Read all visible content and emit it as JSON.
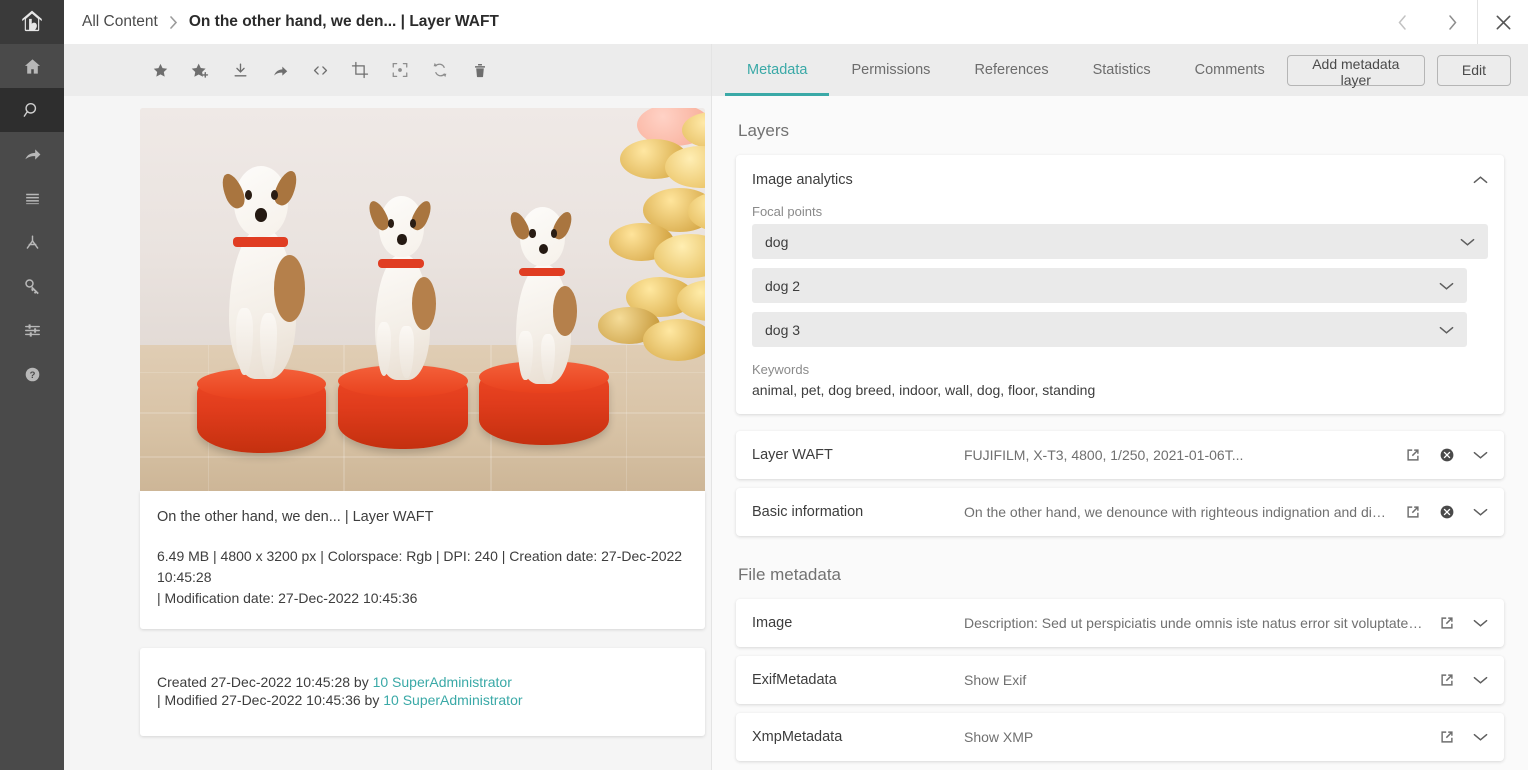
{
  "brand": {
    "accent": "#3aa9a7",
    "logo_icon": "house-monogram-logo"
  },
  "header": {
    "breadcrumb_root": "All Content",
    "breadcrumb_separator": "›",
    "title": "On the other hand, we den... | Layer WAFT",
    "prev_icon": "chevron-left-icon",
    "next_icon": "chevron-right-icon",
    "close_icon": "close-icon"
  },
  "rail": {
    "items": [
      {
        "icon": "home-icon",
        "name": "home",
        "active": false
      },
      {
        "icon": "search-icon",
        "name": "search",
        "active": true
      },
      {
        "icon": "share-arrow-icon",
        "name": "share",
        "active": false
      },
      {
        "icon": "list-icon",
        "name": "list",
        "active": false
      },
      {
        "icon": "hierarchy-icon",
        "name": "hierarchy",
        "active": false
      },
      {
        "icon": "key-icon",
        "name": "key",
        "active": false
      },
      {
        "icon": "sliders-icon",
        "name": "settings",
        "active": false
      },
      {
        "icon": "help-icon",
        "name": "help",
        "active": false
      }
    ]
  },
  "toolbar": {
    "buttons": [
      {
        "icon": "star-icon",
        "name": "favorite"
      },
      {
        "icon": "star-plus-icon",
        "name": "add-to-collection"
      },
      {
        "icon": "download-icon",
        "name": "download"
      },
      {
        "icon": "share-icon",
        "name": "share"
      },
      {
        "icon": "code-icon",
        "name": "embed-code"
      },
      {
        "icon": "crop-icon",
        "name": "crop"
      },
      {
        "icon": "focus-point-icon",
        "name": "focus-point"
      },
      {
        "icon": "refresh-icon",
        "name": "replace"
      },
      {
        "icon": "trash-icon",
        "name": "delete"
      }
    ]
  },
  "asset": {
    "preview_alt": "Three Jack Russell terriers standing on red podiums with gold balloons",
    "title": "On the other hand, we den... | Layer WAFT",
    "meta_line1": "6.49 MB | 4800 x 3200 px | Colorspace: Rgb | DPI: 240 | Creation date: 27-Dec-2022 10:45:28",
    "meta_line2": "| Modification date: 27-Dec-2022 10:45:36",
    "created_prefix": "Created 27-Dec-2022 10:45:28 by ",
    "created_user": "10 SuperAdministrator",
    "modified_prefix": "| Modified 27-Dec-2022 10:45:36 by ",
    "modified_user": "10 SuperAdministrator"
  },
  "tabs": [
    {
      "label": "Metadata",
      "active": true
    },
    {
      "label": "Permissions",
      "active": false
    },
    {
      "label": "References",
      "active": false
    },
    {
      "label": "Statistics",
      "active": false
    },
    {
      "label": "Comments",
      "active": false
    }
  ],
  "tab_actions": {
    "add_layer_label": "Add metadata layer",
    "edit_label": "Edit"
  },
  "layers": {
    "section_title": "Layers",
    "analytics": {
      "title": "Image analytics",
      "collapse_icon": "chevron-up-icon",
      "focal_points_label": "Focal points",
      "focal_points": [
        {
          "name": "dog",
          "expand_icon": "chevron-down-icon"
        },
        {
          "name": "dog 2",
          "expand_icon": "chevron-down-icon"
        },
        {
          "name": "dog 3",
          "expand_icon": "chevron-down-icon"
        }
      ],
      "keywords_label": "Keywords",
      "keywords_value": "animal, pet, dog breed, indoor, wall, dog, floor, standing"
    },
    "rows": [
      {
        "name": "Layer WAFT",
        "value": "FUJIFILM, X-T3, 4800, 1/250, 2021-01-06T...",
        "open_icon": "external-link-icon",
        "remove_icon": "remove-circle-icon",
        "expand_icon": "chevron-down-icon"
      },
      {
        "name": "Basic information",
        "value": "On the other hand, we denounce with righteous indignation and dislike men who are …",
        "open_icon": "external-link-icon",
        "remove_icon": "remove-circle-icon",
        "expand_icon": "chevron-down-icon"
      }
    ]
  },
  "file_metadata": {
    "section_title": "File metadata",
    "rows": [
      {
        "name": "Image",
        "value": "Description: Sed ut perspiciatis unde omnis iste natus error sit voluptatem accusantium dol…",
        "open_icon": "external-link-icon",
        "expand_icon": "chevron-down-icon"
      },
      {
        "name": "ExifMetadata",
        "value": "Show Exif",
        "open_icon": "external-link-icon",
        "expand_icon": "chevron-down-icon"
      },
      {
        "name": "XmpMetadata",
        "value": "Show XMP",
        "open_icon": "external-link-icon",
        "expand_icon": "chevron-down-icon"
      }
    ]
  }
}
